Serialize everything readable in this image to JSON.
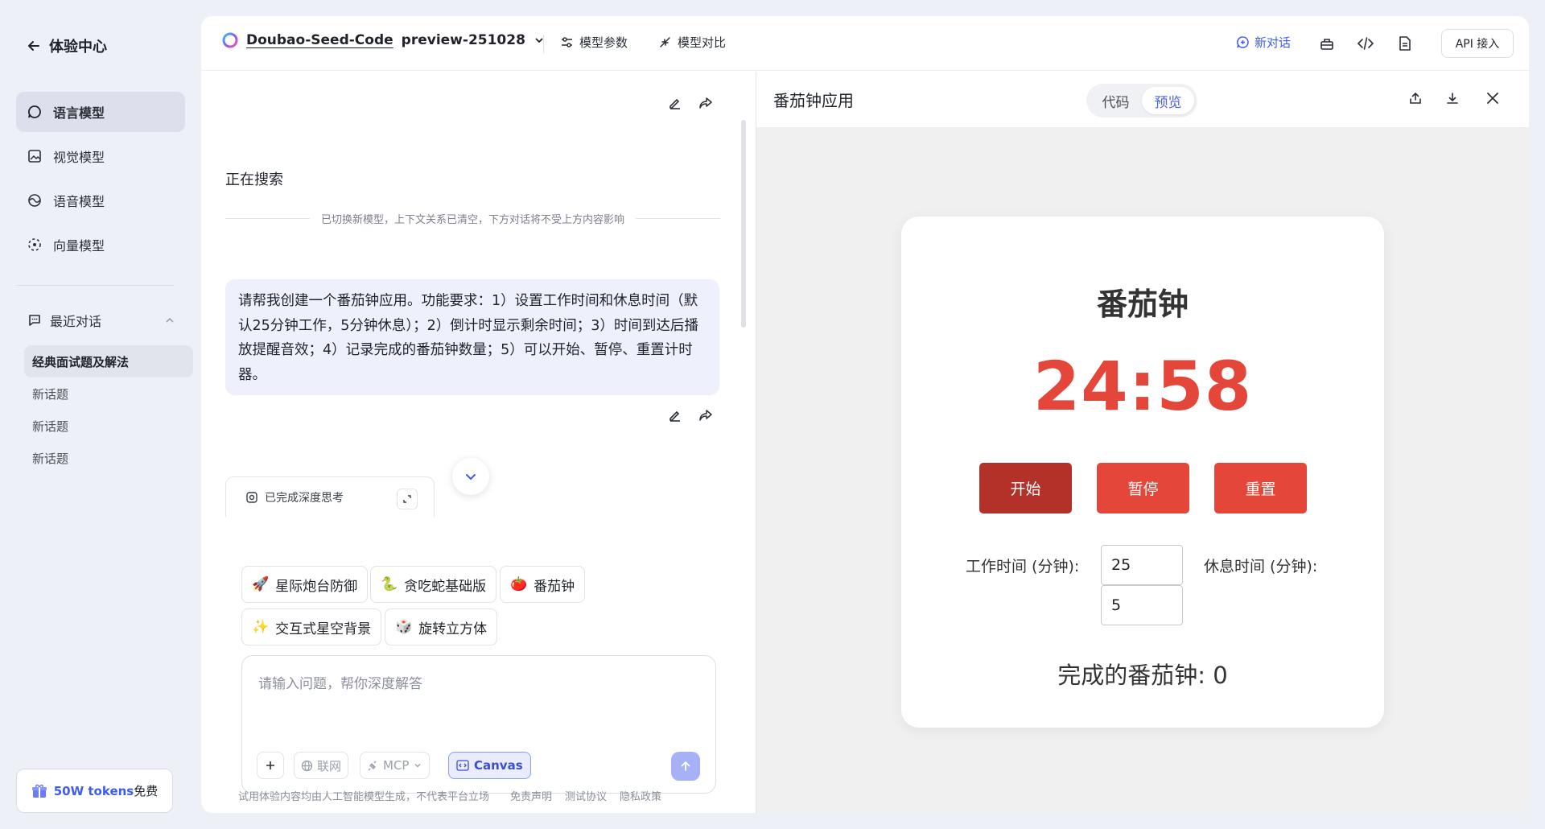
{
  "sidebar": {
    "back_label": "体验中心",
    "nav": [
      {
        "label": "语言模型",
        "icon": "chat-circle-icon",
        "active": true
      },
      {
        "label": "视觉模型",
        "icon": "image-icon",
        "active": false
      },
      {
        "label": "语音模型",
        "icon": "audio-wave-icon",
        "active": false
      },
      {
        "label": "向量模型",
        "icon": "vector-icon",
        "active": false
      }
    ],
    "recent_label": "最近对话",
    "conversations": [
      {
        "label": "经典面试题及解法",
        "active": true
      },
      {
        "label": "新话题",
        "active": false
      },
      {
        "label": "新话题",
        "active": false
      },
      {
        "label": "新话题",
        "active": false
      }
    ],
    "tokens_promo": {
      "highlight": "50W tokens",
      "suffix": "免费"
    }
  },
  "topbar": {
    "model_name": "Doubao-Seed-Code",
    "model_version": "preview-251028",
    "params_label": "模型参数",
    "compare_label": "模型对比",
    "new_chat_label": "新对话",
    "api_label": "API 接入"
  },
  "chat": {
    "status_text": "正在搜索",
    "system_notice": "已切换新模型，上下文关系已清空，下方对话将不受上方内容影响",
    "user_message": "请帮我创建一个番茄钟应用。功能要求：1）设置工作时间和休息时间（默认25分钟工作，5分钟休息）；2）倒计时显示剩余时间；3）时间到达后播放提醒音效；4）记录完成的番茄钟数量；5）可以开始、暂停、重置计时器。",
    "deep_thinking_label": "已完成深度思考",
    "suggestions": [
      {
        "emoji": "🚀",
        "label": "星际炮台防御"
      },
      {
        "emoji": "🐍",
        "label": "贪吃蛇基础版"
      },
      {
        "emoji": "🍅",
        "label": "番茄钟"
      },
      {
        "emoji": "✨",
        "label": "交互式星空背景"
      },
      {
        "emoji": "🎲",
        "label": "旋转立方体"
      }
    ],
    "input_placeholder": "请输入问题，帮你深度解答",
    "web_label": "联网",
    "mcp_label": "MCP",
    "canvas_label": "Canvas",
    "footer_disclaimer": "试用体验内容均由人工智能模型生成，不代表平台立场",
    "footer_links": [
      "免责声明",
      "测试协议",
      "隐私政策"
    ]
  },
  "canvas": {
    "title": "番茄钟应用",
    "tab_code": "代码",
    "tab_preview": "预览",
    "active_tab": "预览"
  },
  "pomodoro": {
    "title": "番茄钟",
    "timer": "24:58",
    "start_label": "开始",
    "pause_label": "暂停",
    "reset_label": "重置",
    "work_label": "工作时间 (分钟):",
    "work_value": "25",
    "break_label": "休息时间 (分钟):",
    "break_value": "5",
    "completed_text": "完成的番茄钟: 0"
  },
  "colors": {
    "accent": "#3d5bf5",
    "timer_red": "#e5463a",
    "start_btn": "#b33128",
    "page_bg": "#eef0f8"
  }
}
